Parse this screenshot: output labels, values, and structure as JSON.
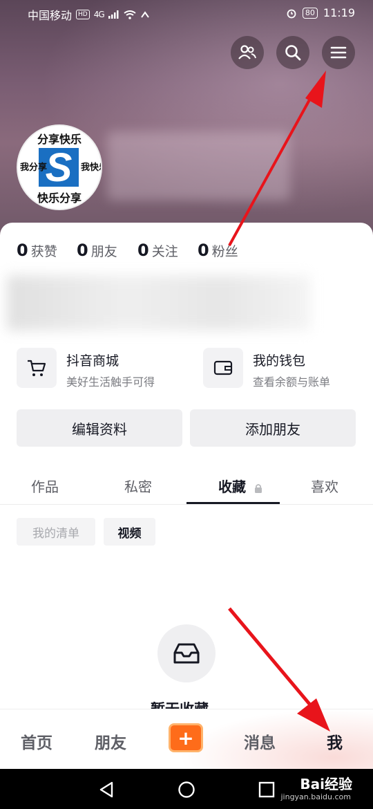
{
  "status_bar": {
    "carrier": "中国移动",
    "hd": "HD",
    "network": "4G",
    "battery": "80",
    "time": "11:19"
  },
  "header_icons": [
    "friends-icon",
    "search-icon",
    "menu-icon"
  ],
  "avatar": {
    "text_top": "分享快乐",
    "text_left": "我分享",
    "text_right": "我快乐",
    "text_bottom": "快乐分享",
    "logo_letter": "S"
  },
  "stats": [
    {
      "num": "0",
      "label": "获赞"
    },
    {
      "num": "0",
      "label": "朋友"
    },
    {
      "num": "0",
      "label": "关注"
    },
    {
      "num": "0",
      "label": "粉丝"
    }
  ],
  "services": [
    {
      "title": "抖音商城",
      "subtitle": "美好生活触手可得",
      "icon": "cart-icon"
    },
    {
      "title": "我的钱包",
      "subtitle": "查看余额与账单",
      "icon": "wallet-icon"
    }
  ],
  "buttons": {
    "edit_profile": "编辑资料",
    "add_friend": "添加朋友"
  },
  "tabs": [
    {
      "label": "作品"
    },
    {
      "label": "私密"
    },
    {
      "label": "收藏",
      "active": true,
      "locked": true
    },
    {
      "label": "喜欢"
    }
  ],
  "chips": {
    "my_list": "我的清单",
    "video": "视频"
  },
  "empty_state": {
    "text": "暂无收藏"
  },
  "bottom_nav": {
    "home": "首页",
    "friends": "朋友",
    "plus": "+",
    "messages": "消息",
    "me": "我"
  },
  "watermark": {
    "brand": "Bai经验",
    "url": "jingyan.baidu.com"
  },
  "colors": {
    "accent_orange": "#fe6c1a",
    "arrow_red": "#e8141b",
    "text_primary": "#161823"
  }
}
